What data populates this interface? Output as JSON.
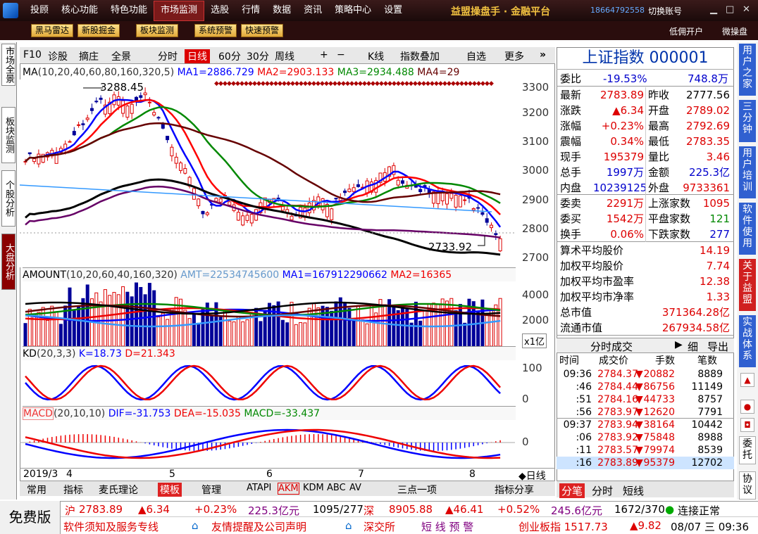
{
  "topbar": {
    "menu": [
      "投顾",
      "核心功能",
      "特色功能",
      "市场监测",
      "选股",
      "行情",
      "数据",
      "资讯",
      "策略中心",
      "设置"
    ],
    "active_index": 3,
    "brand": "益盟操盘手 · 金融平台",
    "phone": "18664792558",
    "switch_account": "切换账号"
  },
  "toolbar2": {
    "buttons": [
      "黑马雷达",
      "新股掘金",
      "板块监测",
      "系统预警",
      "快速预警"
    ],
    "right": [
      "低佣开户",
      "微操盘"
    ]
  },
  "left_tabs": [
    "市场全景",
    "板块监测",
    "个股分析",
    "大盘分析"
  ],
  "chart_toolbar": {
    "items": [
      "F10",
      "诊股",
      "摘庄",
      "全景",
      "分时",
      "日线",
      "60分",
      "30分",
      "周线",
      "+",
      "−",
      "K线",
      "指数叠加",
      "自选",
      "更多"
    ],
    "selected": "日线"
  },
  "ma_legend": {
    "name": "MA",
    "params": "(10,20,40,60,80,160,320,5)",
    "ma1": "MA1=2886.729",
    "ma2": "MA2=2903.133",
    "ma3": "MA3=2934.488",
    "ma4": "MA4=29"
  },
  "price_axis": [
    "3300",
    "3200",
    "3100",
    "3000",
    "2900",
    "2800",
    "2700"
  ],
  "price_annotations": {
    "high": "3288.45",
    "low": "2733.92"
  },
  "amount_legend": {
    "name": "AMOUNT",
    "params": "(10,20,60,40,160,320)",
    "amt": "AMT=22534745600",
    "ma1": "MA1=167912290662",
    "ma2": "MA2=16365"
  },
  "amount_axis": [
    "4000",
    "2000"
  ],
  "amount_unit": "x1亿",
  "kd_legend": {
    "name": "KD",
    "params": "(20,3,3)",
    "k": "K=18.73",
    "d": "D=21.343"
  },
  "kd_axis": [
    "100",
    "0"
  ],
  "macd_legend": {
    "name": "MACD",
    "params": "(20,10,10)",
    "dif": "DIF=-31.753",
    "dea": "DEA=-15.035",
    "macd": "MACD=-33.437"
  },
  "macd_axis": [
    "0"
  ],
  "date_axis": [
    "2019/3",
    "4",
    "5",
    "6",
    "7",
    "8"
  ],
  "period_label": "◆日线",
  "bottom_tabs": [
    "常用",
    "指标",
    "麦氏理论",
    "模板",
    "管理",
    "ATAPI",
    "AKM",
    "KDM",
    "ABC",
    "AV",
    "三点一项",
    "指标分享"
  ],
  "quote": {
    "title": "上证指数 000001",
    "weibi_label": "委比",
    "weibi": "-19.53%",
    "weicha": "748.8万",
    "rows": [
      {
        "l1": "最新",
        "v1": "2783.89",
        "l2": "昨收",
        "v2": "2777.56",
        "c1": "red",
        "c2": "black"
      },
      {
        "l1": "涨跌",
        "v1": "▲6.34",
        "l2": "开盘",
        "v2": "2789.02",
        "c1": "red",
        "c2": "red"
      },
      {
        "l1": "涨幅",
        "v1": "+0.23%",
        "l2": "最高",
        "v2": "2792.69",
        "c1": "red",
        "c2": "red"
      },
      {
        "l1": "震幅",
        "v1": "0.34%",
        "l2": "最低",
        "v2": "2783.35",
        "c1": "red",
        "c2": "red"
      },
      {
        "l1": "现手",
        "v1": "195379",
        "l2": "量比",
        "v2": "3.46",
        "c1": "red",
        "c2": "red"
      },
      {
        "l1": "总手",
        "v1": "1997万",
        "l2": "金额",
        "v2": "225.3亿",
        "c1": "blue",
        "c2": "blue"
      },
      {
        "l1": "内盘",
        "v1": "10239125",
        "l2": "外盘",
        "v2": "9733361",
        "c1": "blue",
        "c2": "red"
      }
    ],
    "rows2": [
      {
        "l1": "委卖",
        "v1": "2291万",
        "l2": "上涨家数",
        "v2": "1095",
        "c1": "red",
        "c2": "red"
      },
      {
        "l1": "委买",
        "v1": "1542万",
        "l2": "平盘家数",
        "v2": "121",
        "c1": "red",
        "c2": "green"
      },
      {
        "l1": "换手",
        "v1": "0.06%",
        "l2": "下跌家数",
        "v2": "277",
        "c1": "red",
        "c2": "blue"
      }
    ],
    "stats": [
      {
        "l": "算术平均股价",
        "v": "14.19"
      },
      {
        "l": "加权平均股价",
        "v": "7.74"
      },
      {
        "l": "加权平均市盈率",
        "v": "12.38"
      },
      {
        "l": "加权平均市净率",
        "v": "1.33"
      },
      {
        "l": "总市值",
        "v": "371364.28亿"
      },
      {
        "l": "流通市值",
        "v": "267934.58亿"
      }
    ],
    "tick_title": "分时成交",
    "tick_btns": [
      "细",
      "导出"
    ],
    "tick_cols": [
      "时间",
      "成交价",
      "手数",
      "笔数"
    ],
    "ticks": [
      {
        "t": "09:36",
        "p": "2784.37",
        "v": "20882",
        "n": "8889"
      },
      {
        "t": ":46",
        "p": "2784.44",
        "v": "86756",
        "n": "11149"
      },
      {
        "t": ":51",
        "p": "2784.16",
        "v": "44733",
        "n": "8757"
      },
      {
        "t": ":56",
        "p": "2783.97",
        "v": "12620",
        "n": "7791"
      },
      {
        "t": "09:37",
        "p": "2783.94",
        "v": "38164",
        "n": "10442"
      },
      {
        "t": ":06",
        "p": "2783.92",
        "v": "75848",
        "n": "8988"
      },
      {
        "t": ":11",
        "p": "2783.57",
        "v": "79974",
        "n": "8539"
      },
      {
        "t": ":16",
        "p": "2783.89",
        "v": "95379",
        "n": "12702"
      }
    ],
    "bottom_tabs": [
      "分笔",
      "分时",
      "短线"
    ]
  },
  "right_tabs": [
    "用户之家",
    "三分钟",
    "用户培训",
    "软件使用",
    "关于益盟",
    "实战体系",
    "委托",
    "协议"
  ],
  "status": {
    "free": "免费版",
    "sh": {
      "name": "沪",
      "price": "2783.89",
      "chg": "▲6.34",
      "pct": "+0.23%",
      "amt": "225.3亿元",
      "ratio": "1095/277"
    },
    "sz": {
      "name": "深",
      "price": "8905.88",
      "chg": "▲46.41",
      "pct": "+0.52%",
      "amt": "245.6亿元",
      "ratio": "1672/370"
    },
    "conn": "连接正常",
    "line2": [
      "软件须知及服务专线",
      "友情提醒及公司声明",
      "深交所",
      "短 线 预 警"
    ],
    "cyb": "创业板指 1517.73",
    "cyb_chg": "▲9.82",
    "datetime": "08/07 三 09:36"
  },
  "colors": {
    "up": "#dd0000",
    "down": "#000099",
    "ma1": "#0000ff",
    "ma2": "#ff0000",
    "ma3": "#008800",
    "ma4": "#660000",
    "ma5": "#000000",
    "ma6": "#660066"
  }
}
